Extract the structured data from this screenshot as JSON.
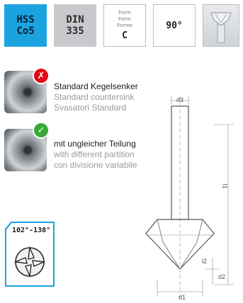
{
  "badges": {
    "material": {
      "line1": "HSS",
      "line2": "Co5"
    },
    "standard": {
      "line1": "DIN",
      "line2": "335"
    },
    "form": {
      "label1": "Form",
      "label2": "Form",
      "label3": "Forme",
      "value": "C"
    },
    "angle": "90°"
  },
  "items": [
    {
      "line1": "Standard Kegelsenker",
      "line2": "Standard countersink",
      "line3": "Svasatori Standard",
      "status_icon": "cross-icon"
    },
    {
      "line1": "mit ungleicher Teilung",
      "line2": "with different partition",
      "line3": "con divisione variabile",
      "status_icon": "check-icon"
    }
  ],
  "angle_range": "102°-138°",
  "drawing": {
    "d3": "d3",
    "l1": "l1",
    "l2": "l2",
    "d2": "d2",
    "d1": "d1"
  },
  "colors": {
    "hss_blue": "#1ba3df",
    "din_grey": "#c7c9cc",
    "cross_red": "#e30613",
    "check_green": "#39a935"
  }
}
